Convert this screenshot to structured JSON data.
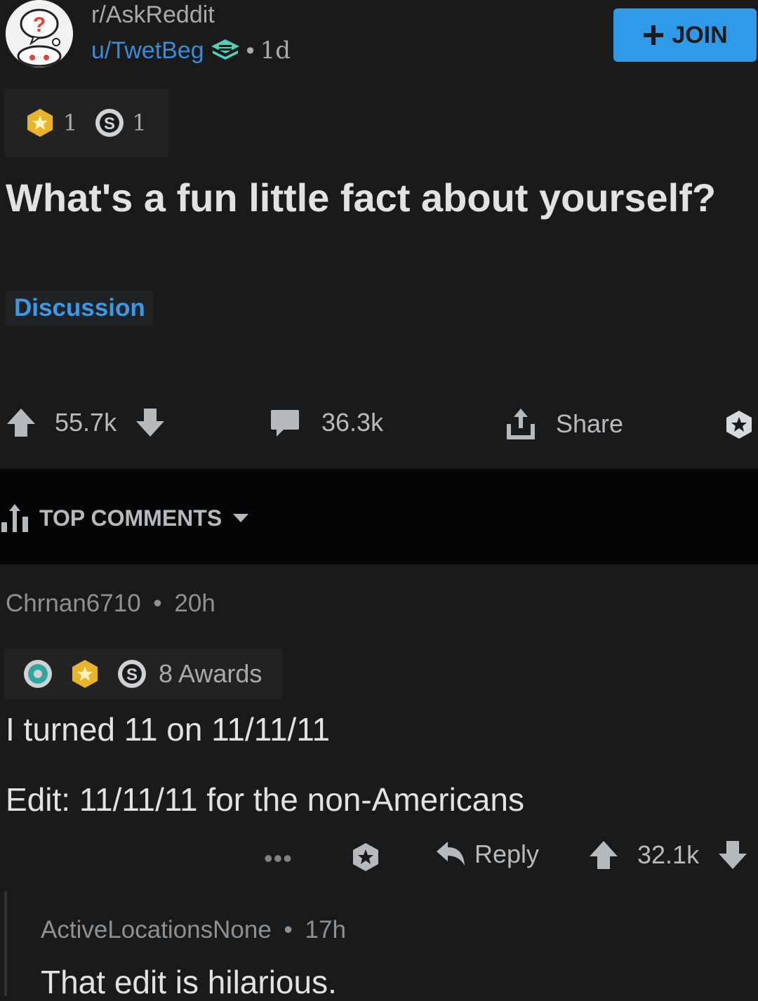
{
  "header": {
    "subreddit": "r/AskReddit",
    "author": "u/TwetBeg",
    "separator": "•",
    "age": "1d",
    "join_label": "JOIN",
    "avatar_icon": "askreddit-snoo-icon",
    "mod_icon": "layers-badge-icon"
  },
  "post": {
    "awards": [
      {
        "icon": "gold-award-icon",
        "count": "1"
      },
      {
        "icon": "silver-award-icon",
        "count": "1"
      }
    ],
    "title": "What's a fun little fact about yourself?",
    "flair": "Discussion",
    "score": "55.7k",
    "comments": "36.3k",
    "share_label": "Share"
  },
  "sort": {
    "label": "TOP COMMENTS"
  },
  "comment": {
    "author": "Chrnan6710",
    "separator": "•",
    "age": "20h",
    "awards_label": "8 Awards",
    "line1": "I turned 11 on 11/11/11",
    "line2": "Edit: 11/11/11 for the non-Americans",
    "more": "•••",
    "reply_label": "Reply",
    "score": "32.1k"
  },
  "reply": {
    "author": "ActiveLocationsNone",
    "separator": "•",
    "age": "17h",
    "body": "That edit is hilarious."
  },
  "colors": {
    "background": "#1a1a1b",
    "accent": "#2f9be8",
    "link": "#3b8bd6",
    "flair": "#3b9ae6"
  }
}
